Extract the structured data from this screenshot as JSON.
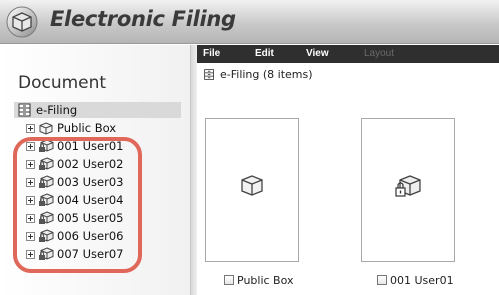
{
  "app": {
    "title": "Electronic Filing"
  },
  "menu": [
    {
      "label": "File",
      "enabled": true
    },
    {
      "label": "Edit",
      "enabled": true
    },
    {
      "label": "View",
      "enabled": true
    },
    {
      "label": "Layout",
      "enabled": false
    }
  ],
  "sidebar": {
    "title": "Document",
    "root": "e-Filing",
    "items": [
      {
        "label": "Public Box",
        "icon": "public-box-icon"
      },
      {
        "label": "001 User01",
        "icon": "locked-box-icon"
      },
      {
        "label": "002 User02",
        "icon": "locked-box-icon"
      },
      {
        "label": "003 User03",
        "icon": "locked-box-icon"
      },
      {
        "label": "004 User04",
        "icon": "locked-box-icon"
      },
      {
        "label": "005 User05",
        "icon": "locked-box-icon"
      },
      {
        "label": "006 User06",
        "icon": "locked-box-icon"
      },
      {
        "label": "007 User07",
        "icon": "locked-box-icon"
      }
    ]
  },
  "content": {
    "header": "e-Filing  (8 items)",
    "cards": [
      {
        "label": "Public Box",
        "icon": "public-box-icon"
      },
      {
        "label": "001 User01",
        "icon": "locked-box-icon"
      }
    ]
  },
  "colors": {
    "highlight": "#e0685a",
    "menubar": "#2f2f2f",
    "selection": "#d9d9d9"
  }
}
